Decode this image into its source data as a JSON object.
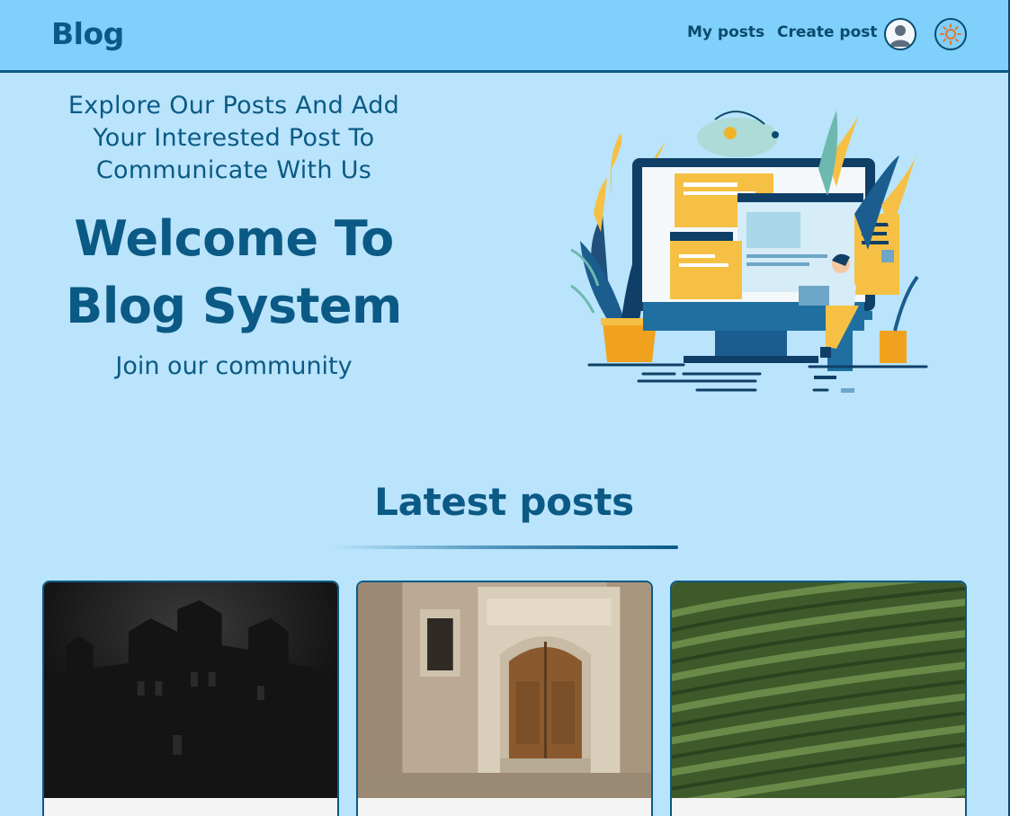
{
  "navbar": {
    "brand": "Blog",
    "links": [
      {
        "label": "My posts"
      },
      {
        "label": "Create post"
      }
    ],
    "user_icon": "user-avatar-icon",
    "theme_icon": "sun-icon"
  },
  "hero": {
    "subtitle": "Explore Our Posts And Add Your Interested Post To Communicate With Us",
    "title": "Welcome To Blog System",
    "tagline": "Join our community",
    "illustration": "person-at-computer-illustration"
  },
  "latest": {
    "title": "Latest posts",
    "cards": [
      {
        "image": "dark-gothic-mansion-photo"
      },
      {
        "image": "old-wooden-door-photo"
      },
      {
        "image": "green-tea-field-photo"
      }
    ]
  },
  "colors": {
    "background": "#b9e4fb",
    "navbar": "#7fd0fb",
    "primary": "#0b5a85"
  }
}
